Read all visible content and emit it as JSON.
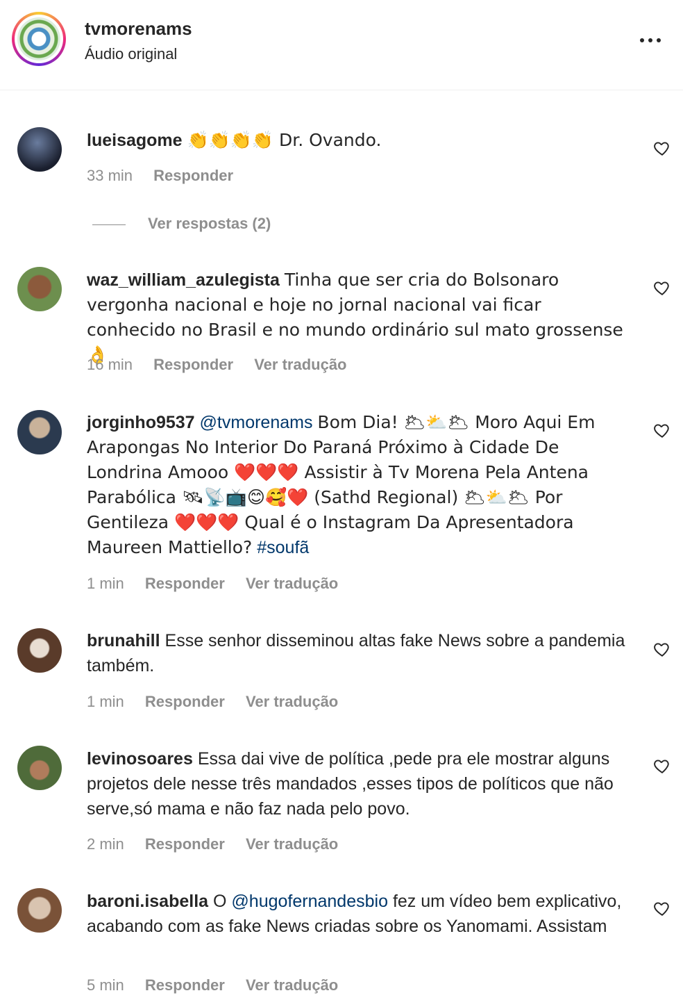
{
  "post_header": {
    "username": "tvmorenams",
    "audio_label": "Áudio original",
    "more_icon": "more-horizontal-icon"
  },
  "comments": [
    {
      "username": "lueisagome",
      "text": "👏👏👏👏 Dr. Ovando.",
      "time": "33 min",
      "reply_label": "Responder",
      "avatar_colors": [
        "#1a1f2e",
        "#5b6b8a"
      ]
    },
    {
      "username": "waz_william_azulegista",
      "text": "Tinha que ser cria do Bolsonaro vergonha nacional e hoje no jornal nacional vai ficar conhecido no Brasil e no mundo ordinário sul mato grossense 👌",
      "time": "16 min",
      "reply_label": "Responder",
      "translate_label": "Ver tradução",
      "avatar_colors": [
        "#6d8f4e",
        "#8c5a3c"
      ]
    },
    {
      "username": "jorginho9537",
      "mention": "@tvmorenams",
      "text": "Bom Dia! 🌥⛅🌥 Moro Aqui Em Arapongas No Interior Do Paraná Próximo à Cidade De Londrina Amooo ❤️❤️❤️ Assistir à Tv Morena Pela Antena Parabólica 🛰📡📺😊🥰❤️ (Sathd Regional) 🌥⛅🌥 Por Gentileza ❤️❤️❤️ Qual é o Instagram Da Apresentadora Maureen Mattiello?",
      "hashtag": "#soufã",
      "time": "1 min",
      "reply_label": "Responder",
      "translate_label": "Ver tradução",
      "avatar_colors": [
        "#2b3a4f",
        "#c9b29a"
      ]
    },
    {
      "username": "brunahill",
      "text": "Esse senhor disseminou altas fake News sobre a pandemia também.",
      "time": "1 min",
      "reply_label": "Responder",
      "translate_label": "Ver tradução",
      "avatar_colors": [
        "#e8ddd2",
        "#5a3b2a"
      ]
    },
    {
      "username": "levinosoares",
      "text": "Essa dai vive de política ,pede pra ele mostrar alguns projetos dele nesse três mandados ,esses tipos de políticos que não serve,só mama e não faz nada pelo povo.",
      "time": "2 min",
      "reply_label": "Responder",
      "translate_label": "Ver tradução",
      "avatar_colors": [
        "#4f6b3a",
        "#b07c5c"
      ]
    },
    {
      "username": "baroni.isabella",
      "pre_text": "O",
      "mention": "@hugofernandesbio",
      "text": "fez um vídeo bem explicativo, acabando com as fake News criadas sobre os Yanomami. Assistam",
      "time": "5 min",
      "reply_label": "Responder",
      "translate_label": "Ver tradução",
      "avatar_colors": [
        "#d9c4b0",
        "#7a5238"
      ]
    }
  ],
  "replies_toggle": {
    "label": "Ver respostas (2)"
  },
  "icons": {
    "like": "heart-outline-icon"
  }
}
